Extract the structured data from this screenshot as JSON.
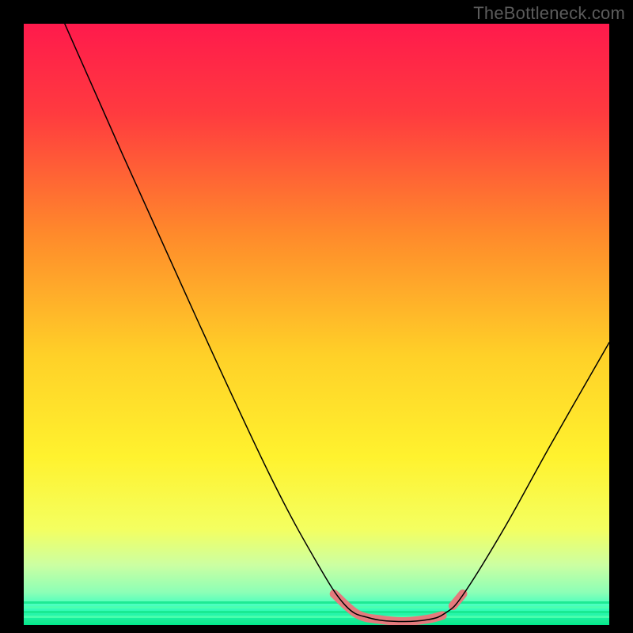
{
  "watermark": {
    "text": "TheBottleneck.com"
  },
  "chart_data": {
    "type": "line",
    "title": "",
    "xlabel": "",
    "ylabel": "",
    "xlim": [
      0,
      100
    ],
    "ylim": [
      0,
      100
    ],
    "background_gradient": {
      "stops": [
        {
          "offset": 0.0,
          "color": "#ff1a4c"
        },
        {
          "offset": 0.15,
          "color": "#ff3b3f"
        },
        {
          "offset": 0.35,
          "color": "#ff8a2b"
        },
        {
          "offset": 0.55,
          "color": "#ffd028"
        },
        {
          "offset": 0.72,
          "color": "#fff22e"
        },
        {
          "offset": 0.84,
          "color": "#f4ff60"
        },
        {
          "offset": 0.9,
          "color": "#ccffa2"
        },
        {
          "offset": 0.945,
          "color": "#8dffb6"
        },
        {
          "offset": 0.97,
          "color": "#3fffc0"
        },
        {
          "offset": 1.0,
          "color": "#00e88a"
        }
      ]
    },
    "series": [
      {
        "name": "curve",
        "stroke": "#000000",
        "stroke_width": 1.5,
        "points": [
          {
            "x": 7.0,
            "y": 100.0
          },
          {
            "x": 17.0,
            "y": 78.0
          },
          {
            "x": 30.0,
            "y": 50.0
          },
          {
            "x": 42.0,
            "y": 25.0
          },
          {
            "x": 50.0,
            "y": 10.5
          },
          {
            "x": 55.0,
            "y": 3.2
          },
          {
            "x": 59.0,
            "y": 1.2
          },
          {
            "x": 64.0,
            "y": 0.6
          },
          {
            "x": 69.0,
            "y": 0.9
          },
          {
            "x": 72.0,
            "y": 2.0
          },
          {
            "x": 75.0,
            "y": 5.0
          },
          {
            "x": 82.0,
            "y": 16.0
          },
          {
            "x": 90.0,
            "y": 30.0
          },
          {
            "x": 100.0,
            "y": 47.0
          }
        ]
      },
      {
        "name": "highlight",
        "stroke": "#e47a7d",
        "stroke_width": 11,
        "segments": [
          [
            {
              "x": 53.0,
              "y": 5.2
            },
            {
              "x": 57.0,
              "y": 1.8
            },
            {
              "x": 61.0,
              "y": 0.9
            },
            {
              "x": 65.0,
              "y": 0.6
            },
            {
              "x": 69.0,
              "y": 1.0
            },
            {
              "x": 71.5,
              "y": 1.6
            }
          ],
          [
            {
              "x": 73.3,
              "y": 3.2
            },
            {
              "x": 75.0,
              "y": 5.2
            }
          ]
        ]
      }
    ]
  }
}
